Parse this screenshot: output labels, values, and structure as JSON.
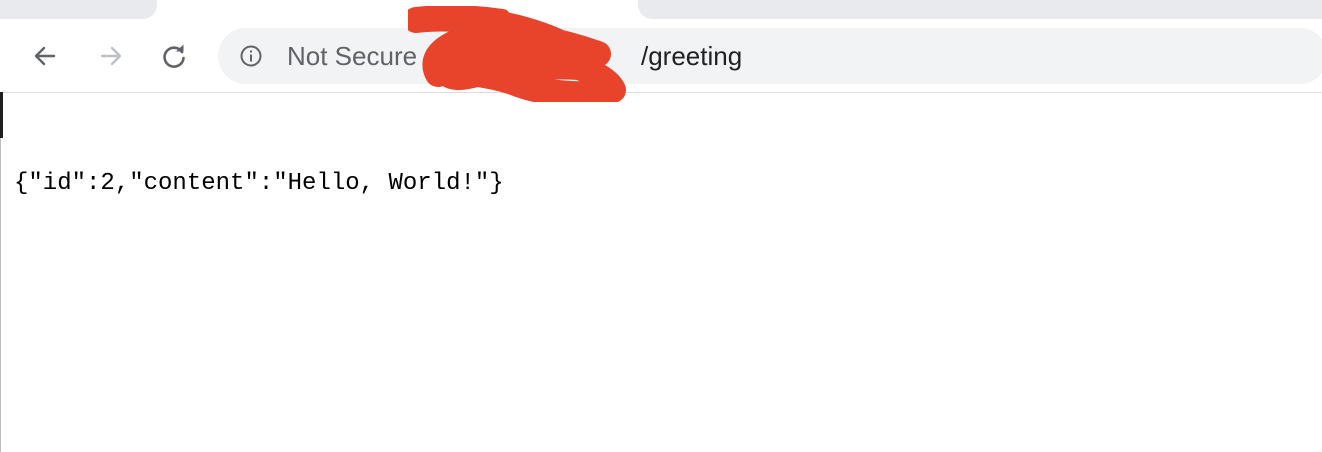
{
  "browser": {
    "nav": {
      "back_icon": "arrow-left-icon",
      "forward_icon": "arrow-right-icon",
      "reload_icon": "reload-icon"
    },
    "omnibox": {
      "security_icon": "info-icon",
      "security_label": "Not Secure",
      "url_path": "/greeting"
    }
  },
  "page": {
    "body_text": "{\"id\":2,\"content\":\"Hello, World!\"}"
  },
  "colors": {
    "redaction": "#e8442c",
    "omnibox_bg": "#f1f3f4",
    "icon_gray": "#5f6368"
  }
}
